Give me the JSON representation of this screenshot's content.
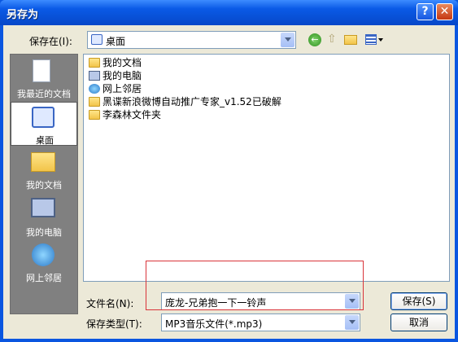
{
  "window": {
    "title": "另存为"
  },
  "toolbar": {
    "save_in_label": "保存在(I):",
    "location_value": "桌面"
  },
  "places": [
    {
      "label": "我最近的文档",
      "icon": "recent-docs-icon"
    },
    {
      "label": "桌面",
      "icon": "desktop-icon"
    },
    {
      "label": "我的文档",
      "icon": "my-documents-icon"
    },
    {
      "label": "我的电脑",
      "icon": "my-computer-icon"
    },
    {
      "label": "网上邻居",
      "icon": "network-icon"
    }
  ],
  "files": [
    {
      "name": "我的文档",
      "icon": "my-documents-icon"
    },
    {
      "name": "我的电脑",
      "icon": "my-computer-icon"
    },
    {
      "name": "网上邻居",
      "icon": "network-icon"
    },
    {
      "name": "黑谍新浪微博自动推广专家_v1.52已破解",
      "icon": "folder-icon"
    },
    {
      "name": "李森林文件夹",
      "icon": "folder-icon"
    }
  ],
  "form": {
    "filename_label": "文件名(N):",
    "filename_value": "庞龙-兄弟抱一下一铃声",
    "filetype_label": "保存类型(T):",
    "filetype_value": "MP3音乐文件(*.mp3)",
    "save_button": "保存(S)",
    "cancel_button": "取消"
  },
  "colors": {
    "titlebar": "#0a5ae6",
    "client": "#ece9d8",
    "places_bg": "#808080",
    "highlight_box": "#d9343a"
  }
}
